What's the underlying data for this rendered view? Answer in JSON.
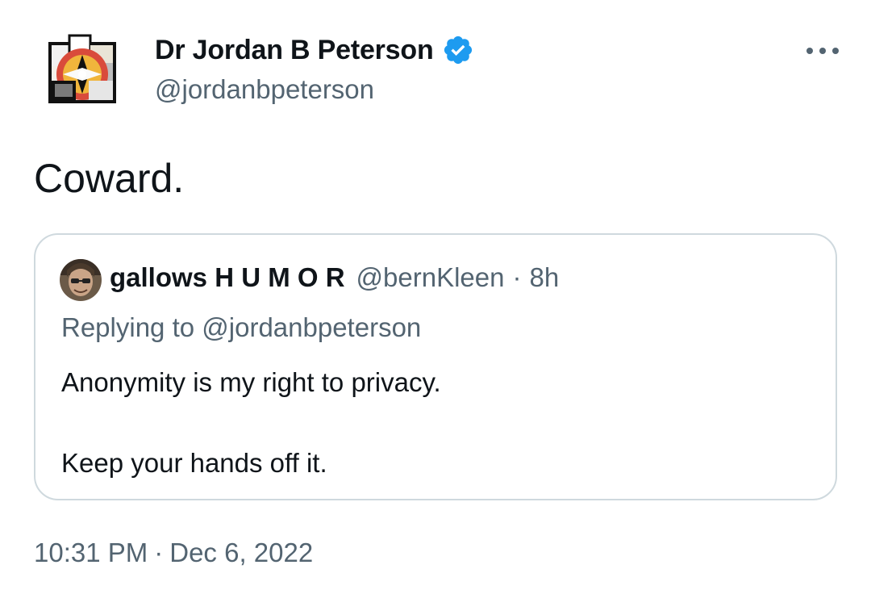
{
  "author": {
    "display_name": "Dr Jordan B Peterson",
    "handle": "@jordanbpeterson",
    "verified": true,
    "avatar_icon": "geometric-logo-avatar"
  },
  "tweet": {
    "text": "Coward."
  },
  "quoted_tweet": {
    "display_name": "gallows H U M O R",
    "handle": "@bernKleen",
    "separator": "·",
    "time_ago": "8h",
    "replying_to": "Replying to @jordanbpeterson",
    "body_lines": [
      "Anonymity is my right to privacy.",
      "Keep your hands off it."
    ]
  },
  "footer": {
    "time": "10:31 PM",
    "separator": "·",
    "date": "Dec 6, 2022"
  },
  "colors": {
    "text_primary": "#0f1419",
    "text_secondary": "#536471",
    "verified_blue": "#1d9bf0",
    "border": "#cfd9de"
  }
}
